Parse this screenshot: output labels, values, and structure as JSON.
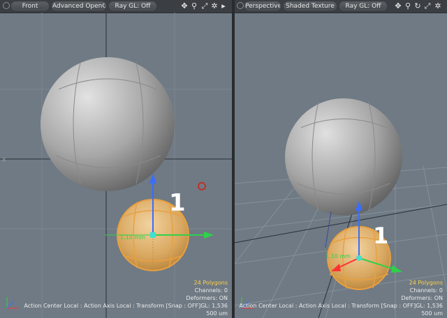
{
  "left_viewport": {
    "buttons": {
      "view": "Front",
      "shading": "Advanced OpenGL",
      "raygl": "Ray GL: Off"
    },
    "icons": [
      "move-view-icon",
      "zoom-icon",
      "maximize-icon",
      "settings-icon",
      "expand-arrow-icon"
    ],
    "measure_label": "1.10 mm",
    "number_badge": "1",
    "axis_side_label": "X",
    "stats": {
      "polygons": "24 Polygons",
      "channels": "Channels: 0",
      "deformers": "Deformers: ON",
      "status_line": "Action Center Local : Action Axis Local : Transform  [Snap : OFF]GL: 1,536",
      "grid_size": "500 um"
    }
  },
  "right_viewport": {
    "buttons": {
      "view": "Perspective",
      "shading": "Shaded Texture",
      "raygl": "Ray GL: Off"
    },
    "icons": [
      "move-view-icon",
      "zoom-icon",
      "rotate-icon",
      "maximize-icon",
      "settings-icon"
    ],
    "measure_label": "1.10 mm",
    "number_badge": "1",
    "stats": {
      "polygons": "24 Polygons",
      "channels": "Channels: 0",
      "deformers": "Deformers: ON",
      "status_line": "Action Center Local : Action Axis Local : Transform  [Snap : OFF]GL: 1,536",
      "grid_size": "500 um"
    }
  },
  "colors": {
    "viewport_bg": "#6f7a84",
    "selection_orange": "#e8a040",
    "stats_highlight": "#ffd24a",
    "axis_x": "#2fd14a",
    "axis_y": "#3a6dff",
    "axis_z": "#ff3333"
  }
}
